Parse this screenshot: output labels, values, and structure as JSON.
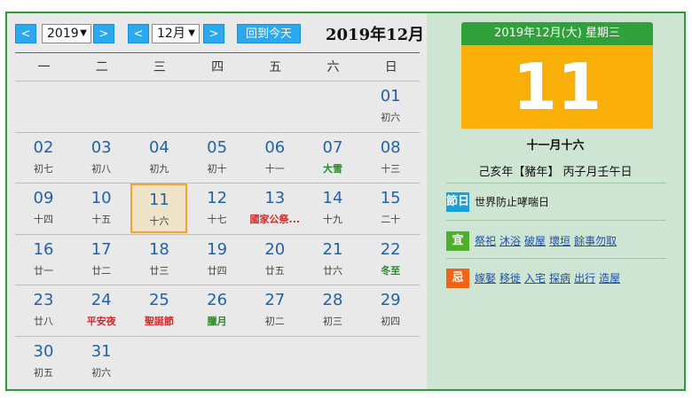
{
  "nav": {
    "prev_year": "<",
    "year": "2019",
    "next_year": ">",
    "prev_month": "<",
    "month": "12月",
    "next_month": ">",
    "today_label": "回到今天",
    "current": "2019年12月"
  },
  "weekdays": [
    "一",
    "二",
    "三",
    "四",
    "五",
    "六",
    "日"
  ],
  "weeks": [
    [
      null,
      null,
      null,
      null,
      null,
      null,
      {
        "day": "01",
        "lunar": "初六",
        "style": ""
      }
    ],
    [
      {
        "day": "02",
        "lunar": "初七",
        "style": ""
      },
      {
        "day": "03",
        "lunar": "初八",
        "style": ""
      },
      {
        "day": "04",
        "lunar": "初九",
        "style": ""
      },
      {
        "day": "05",
        "lunar": "初十",
        "style": ""
      },
      {
        "day": "06",
        "lunar": "十一",
        "style": ""
      },
      {
        "day": "07",
        "lunar": "大雪",
        "style": "green"
      },
      {
        "day": "08",
        "lunar": "十三",
        "style": ""
      }
    ],
    [
      {
        "day": "09",
        "lunar": "十四",
        "style": ""
      },
      {
        "day": "10",
        "lunar": "十五",
        "style": ""
      },
      {
        "day": "11",
        "lunar": "十六",
        "style": "",
        "today": true
      },
      {
        "day": "12",
        "lunar": "十七",
        "style": ""
      },
      {
        "day": "13",
        "lunar": "國家公祭...",
        "style": "red"
      },
      {
        "day": "14",
        "lunar": "十九",
        "style": ""
      },
      {
        "day": "15",
        "lunar": "二十",
        "style": ""
      }
    ],
    [
      {
        "day": "16",
        "lunar": "廿一",
        "style": ""
      },
      {
        "day": "17",
        "lunar": "廿二",
        "style": ""
      },
      {
        "day": "18",
        "lunar": "廿三",
        "style": ""
      },
      {
        "day": "19",
        "lunar": "廿四",
        "style": ""
      },
      {
        "day": "20",
        "lunar": "廿五",
        "style": ""
      },
      {
        "day": "21",
        "lunar": "廿六",
        "style": ""
      },
      {
        "day": "22",
        "lunar": "冬至",
        "style": "green"
      }
    ],
    [
      {
        "day": "23",
        "lunar": "廿八",
        "style": ""
      },
      {
        "day": "24",
        "lunar": "平安夜",
        "style": "red"
      },
      {
        "day": "25",
        "lunar": "聖誕節",
        "style": "red"
      },
      {
        "day": "26",
        "lunar": "臘月",
        "style": "green"
      },
      {
        "day": "27",
        "lunar": "初二",
        "style": ""
      },
      {
        "day": "28",
        "lunar": "初三",
        "style": ""
      },
      {
        "day": "29",
        "lunar": "初四",
        "style": ""
      }
    ],
    [
      {
        "day": "30",
        "lunar": "初五",
        "style": ""
      },
      {
        "day": "31",
        "lunar": "初六",
        "style": ""
      },
      null,
      null,
      null,
      null,
      null
    ]
  ],
  "detail": {
    "header": "2019年12月(大) 星期三",
    "big_day": "11",
    "lunar_date": "十一月十六",
    "ganzhi": "己亥年【豬年】 丙子月壬午日",
    "festival_tag": "節日",
    "festival": "世界防止哮喘日",
    "yi_tag": "宜",
    "yi": [
      "祭祀",
      "沐浴",
      "破屋",
      "壞垣",
      "餘事勿取"
    ],
    "ji_tag": "忌",
    "ji": [
      "嫁娶",
      "移徙",
      "入宅",
      "探病",
      "出行",
      "造屋"
    ]
  },
  "colors": {
    "accent_blue": "#2aa8f0",
    "header_green": "#2fa03a",
    "day_orange": "#f9ae08",
    "festival_tag": "#1aa0d8",
    "yi_tag": "#4cae2a",
    "ji_tag": "#f06418"
  }
}
